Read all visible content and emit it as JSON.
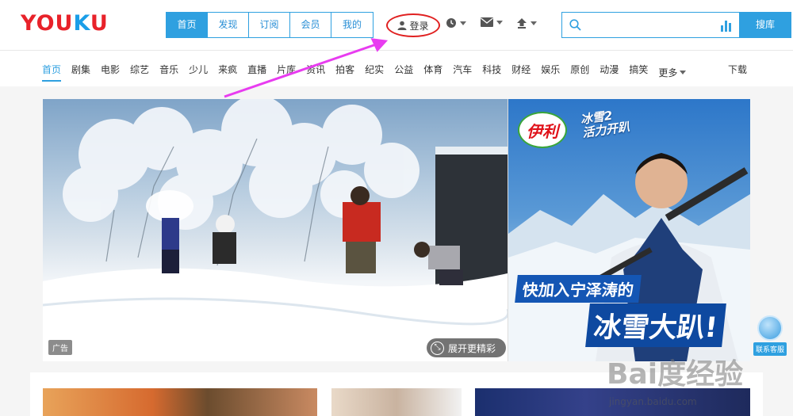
{
  "header": {
    "logo": {
      "part1": "YOU",
      "part2": "K",
      "part3": "U"
    },
    "tabs": [
      {
        "label": "首页",
        "active": true
      },
      {
        "label": "发现",
        "active": false
      },
      {
        "label": "订阅",
        "active": false
      },
      {
        "label": "会员",
        "active": false
      },
      {
        "label": "我的",
        "active": false
      }
    ],
    "login_label": "登录",
    "icons": [
      "history-icon",
      "message-icon",
      "upload-icon"
    ],
    "search": {
      "placeholder": "",
      "button_label": "搜库"
    }
  },
  "categories": [
    "首页",
    "剧集",
    "电影",
    "综艺",
    "音乐",
    "少儿",
    "来疯",
    "直播",
    "片库",
    "资讯",
    "拍客",
    "纪实",
    "公益",
    "体育",
    "汽车",
    "科技",
    "财经",
    "娱乐",
    "原创",
    "动漫",
    "搞笑"
  ],
  "more_label": "更多",
  "download_label": "下载",
  "banner": {
    "ad_tag": "广告",
    "expand_label": "展开更精彩",
    "brand": "伊利",
    "campaign_line1": "冰雪2",
    "campaign_line2": "活力开趴",
    "slogan_line1": "快加入宁泽涛的",
    "slogan_line2": "冰雪大趴!"
  },
  "service_label": "联系客服",
  "watermark": {
    "text": "Bai度经验",
    "url": "jingyan.baidu.com"
  },
  "colors": {
    "accent": "#2fa0e0",
    "logo_red": "#e8222a",
    "logo_blue": "#1a9ee8",
    "annotation": "#e83cf0",
    "login_circle": "#e02020"
  }
}
